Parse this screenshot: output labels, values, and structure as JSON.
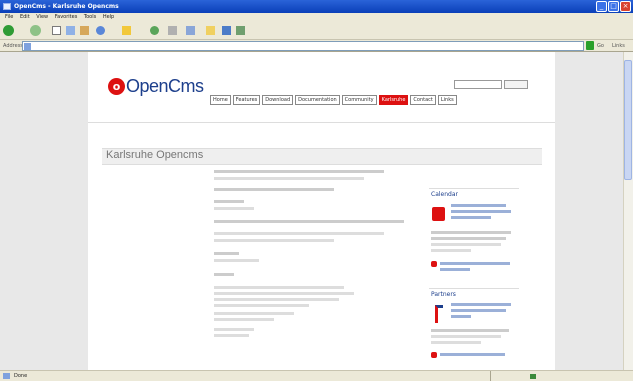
{
  "window": {
    "title": "OpenCms - Karlsruhe Opencms",
    "min_label": "_",
    "max_label": "□",
    "close_label": "×"
  },
  "menubar": [
    "File",
    "Edit",
    "View",
    "Favorites",
    "Tools",
    "Help"
  ],
  "address": {
    "label": "Address",
    "value": "",
    "go_label": "Go",
    "links_label": "Links"
  },
  "site": {
    "logo_mark": "o",
    "logo_text": "OpenCms",
    "tagline": "",
    "search_label": "",
    "search_button": "",
    "nav": [
      {
        "label": "Home",
        "active": false
      },
      {
        "label": "Features",
        "active": false
      },
      {
        "label": "Download",
        "active": false
      },
      {
        "label": "Documentation",
        "active": false
      },
      {
        "label": "Community",
        "active": false
      },
      {
        "label": "Karlsruhe",
        "active": true
      },
      {
        "label": "Contact",
        "active": false
      },
      {
        "label": "Links",
        "active": false
      }
    ],
    "breadcrumb": "",
    "heading": "Karlsruhe Opencms"
  },
  "sidebar": {
    "box1_title": "Calendar",
    "box2_title": "Partners"
  },
  "status": {
    "text": "Done",
    "zone": ""
  }
}
